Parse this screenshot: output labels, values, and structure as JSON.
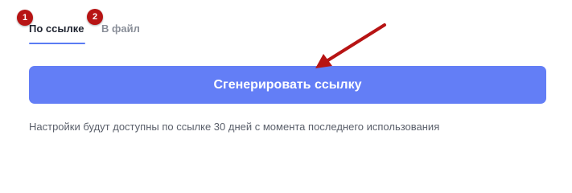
{
  "tabs": {
    "link_label": "По ссылке",
    "file_label": "В файл"
  },
  "annotations": {
    "badge_1": "1",
    "badge_2": "2"
  },
  "action": {
    "generate_label": "Сгенерировать ссылку"
  },
  "hint": {
    "text": "Настройки будут доступны по ссылке 30 дней с момента последнего использования"
  },
  "colors": {
    "accent": "#637ef6",
    "badge": "#b71414",
    "arrow": "#b71414"
  }
}
